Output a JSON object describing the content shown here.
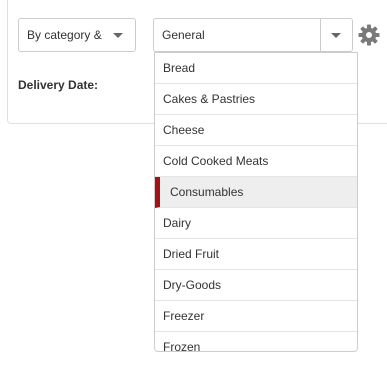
{
  "filters": {
    "mode_value": "By category &",
    "category_value": "General",
    "delivery_date_label": "Delivery Date:"
  },
  "dropdown": {
    "items": [
      "Bread",
      "Cakes & Pastries",
      "Cheese",
      "Cold Cooked Meats",
      "Consumables",
      "Dairy",
      "Dried Fruit",
      "Dry-Goods",
      "Freezer",
      "Frozen"
    ],
    "selected": "Consumables"
  },
  "colors": {
    "accent": "#a50f15",
    "selected_bg": "#eeeeee",
    "border": "#cccccc"
  },
  "icons": {
    "settings": "gear-icon",
    "dropdown_toggle": "chevron-down-icon"
  }
}
